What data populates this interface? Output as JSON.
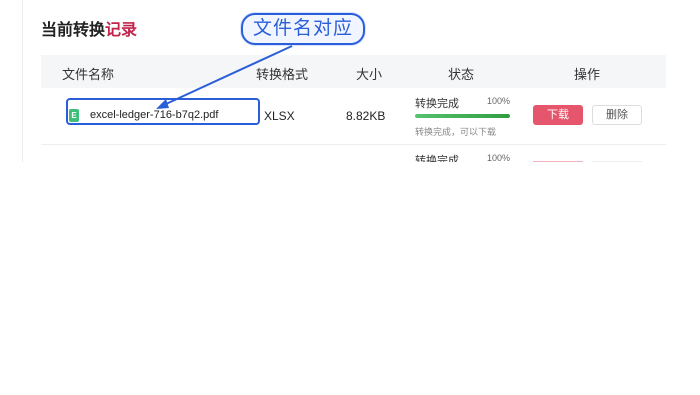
{
  "header": {
    "title_prefix": "当前转换",
    "title_highlight": "记录"
  },
  "columns": {
    "file_name": "文件名称",
    "format": "转换格式",
    "size": "大小",
    "status": "状态",
    "action": "操作"
  },
  "rows": [
    {
      "icon_letter": "E",
      "file_name": "excel-ledger-716-b7q2.pdf",
      "format": "XLSX",
      "size": "8.82KB",
      "status": "转换完成",
      "progress": "100%",
      "hint": "转换完成，可以下载",
      "download_label": "下载",
      "delete_label": "删除"
    },
    {
      "status": "转换完成",
      "progress": "100%"
    }
  ],
  "annotation": {
    "callout_text": "文件名对应"
  },
  "colors": {
    "accent": "#c0264b",
    "download": "#e5566d",
    "annotation": "#2b5fd9",
    "progress": "#3aa84a"
  },
  "icons": {
    "file": "excel-file-icon"
  }
}
